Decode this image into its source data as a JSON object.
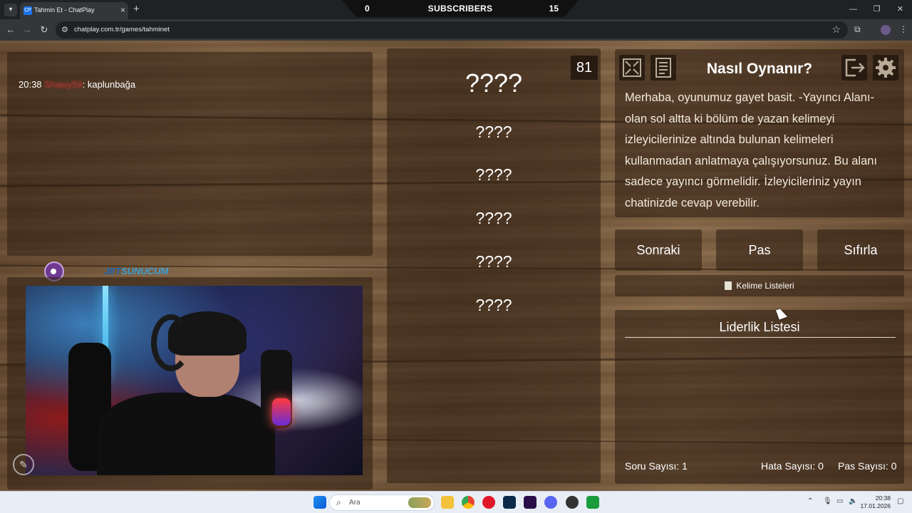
{
  "browser": {
    "tab_title": "Tahmin Et - ChatPlay",
    "tab_favicon_text": "CP",
    "url": "chatplay.com.tr/games/tahminet",
    "new_tab_icon": "plus-icon",
    "close_icon": "close-icon"
  },
  "overlay": {
    "subs_left": "0",
    "subs_title": "SUBSCRIBERS",
    "subs_right": "15"
  },
  "chat": {
    "messages": [
      {
        "time": "20:38",
        "user": "Shawy59",
        "text": ": kaplunbağa",
        "user_color": "#d23a3a"
      }
    ]
  },
  "sponsors": {
    "logo2_prefix": "JET",
    "logo2_suffix": "SUNUCUM"
  },
  "game": {
    "timer": "81",
    "main_word": "????",
    "taboo_words": [
      "????",
      "????",
      "????",
      "????",
      "????"
    ]
  },
  "howto": {
    "title": "Nasıl Oynanır?",
    "body": "Merhaba, oyunumuz gayet basit. -Yayıncı Alanı- olan sol altta ki bölüm de yazan kelimeyi izleyicilerinize altında bulunan kelimeleri kullanmadan anlatmaya çalışıyorsunuz. Bu alanı sadece yayıncı görmelidir. İzleyicileriniz yayın chatinizde cevap verebilir.",
    "icons": [
      "fullscreen-icon",
      "notes-icon",
      "exit-icon",
      "settings-icon"
    ]
  },
  "actions": {
    "next": "Sonraki",
    "pass": "Pas",
    "reset": "Sıfırla",
    "word_lists": "Kelime Listeleri"
  },
  "leaderboard": {
    "title": "Liderlik Listesi",
    "questions_label": "Soru Sayısı: 1",
    "errors_label": "Hata Sayısı: 0",
    "passes_label": "Pas Sayısı: 0"
  },
  "taskbar": {
    "search_placeholder": "Ara",
    "clock_time": "20:38",
    "clock_date": "17.01.2026"
  },
  "colors": {
    "wood": "#7b5c3c",
    "panel": "#2d1e12",
    "chat_username": "#d23a3a"
  }
}
